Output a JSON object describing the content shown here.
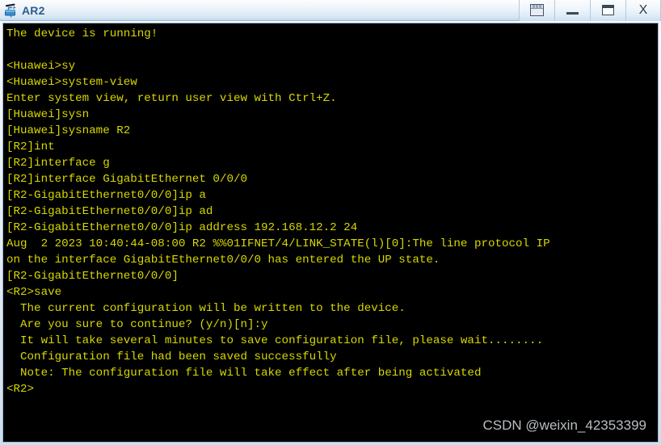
{
  "window": {
    "title": "AR2",
    "icon": "router-icon"
  },
  "titlebar": {
    "buttons": [
      {
        "name": "cascade-windows-button",
        "label": ""
      },
      {
        "name": "minimize-button",
        "label": ""
      },
      {
        "name": "maximize-button",
        "label": ""
      },
      {
        "name": "close-button",
        "label": "X"
      }
    ]
  },
  "terminal": {
    "foreground_color": "#d7d700",
    "background_color": "#000000",
    "lines": [
      "The device is running!",
      "",
      "<Huawei>sy",
      "<Huawei>system-view",
      "Enter system view, return user view with Ctrl+Z.",
      "[Huawei]sysn",
      "[Huawei]sysname R2",
      "[R2]int",
      "[R2]interface g",
      "[R2]interface GigabitEthernet 0/0/0",
      "[R2-GigabitEthernet0/0/0]ip a",
      "[R2-GigabitEthernet0/0/0]ip ad",
      "[R2-GigabitEthernet0/0/0]ip address 192.168.12.2 24",
      "Aug  2 2023 10:40:44-08:00 R2 %%01IFNET/4/LINK_STATE(l)[0]:The line protocol IP",
      "on the interface GigabitEthernet0/0/0 has entered the UP state.",
      "[R2-GigabitEthernet0/0/0]",
      "<R2>save",
      "  The current configuration will be written to the device.",
      "  Are you sure to continue? (y/n)[n]:y",
      "  It will take several minutes to save configuration file, please wait........",
      "  Configuration file had been saved successfully",
      "  Note: The configuration file will take effect after being activated",
      "<R2>"
    ]
  },
  "watermark": {
    "text": "CSDN @weixin_42353399",
    "color": "#b9bec2"
  }
}
